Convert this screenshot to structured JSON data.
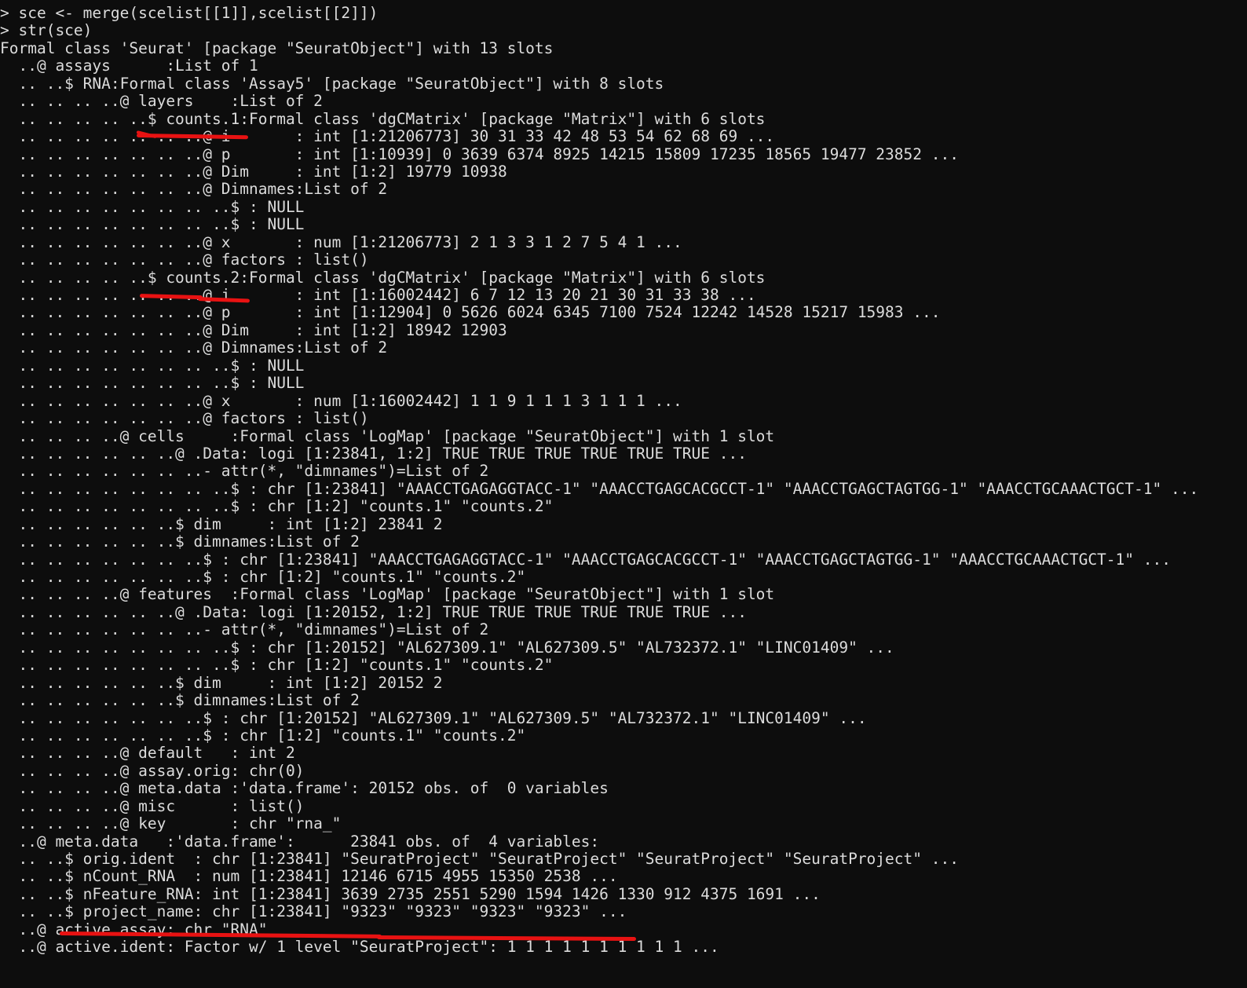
{
  "terminal": {
    "app": "R console",
    "background_color": "#0d0d0d",
    "text_color": "#dcdcdc",
    "annotation_color": "#e81212",
    "prompt": ">"
  },
  "lines": [
    "> sce <- merge(scelist[[1]],scelist[[2]])",
    "> str(sce)",
    "Formal class 'Seurat' [package \"SeuratObject\"] with 13 slots",
    "  ..@ assays      :List of 1",
    "  .. ..$ RNA:Formal class 'Assay5' [package \"SeuratObject\"] with 8 slots",
    "  .. .. .. ..@ layers    :List of 2",
    "  .. .. .. .. ..$ counts.1:Formal class 'dgCMatrix' [package \"Matrix\"] with 6 slots",
    "  .. .. .. .. .. .. ..@ i       : int [1:21206773] 30 31 33 42 48 53 54 62 68 69 ...",
    "  .. .. .. .. .. .. ..@ p       : int [1:10939] 0 3639 6374 8925 14215 15809 17235 18565 19477 23852 ...",
    "  .. .. .. .. .. .. ..@ Dim     : int [1:2] 19779 10938",
    "  .. .. .. .. .. .. ..@ Dimnames:List of 2",
    "  .. .. .. .. .. .. .. ..$ : NULL",
    "  .. .. .. .. .. .. .. ..$ : NULL",
    "  .. .. .. .. .. .. ..@ x       : num [1:21206773] 2 1 3 3 1 2 7 5 4 1 ...",
    "  .. .. .. .. .. .. ..@ factors : list()",
    "  .. .. .. .. ..$ counts.2:Formal class 'dgCMatrix' [package \"Matrix\"] with 6 slots",
    "  .. .. .. .. .. .. ..@ i       : int [1:16002442] 6 7 12 13 20 21 30 31 33 38 ...",
    "  .. .. .. .. .. .. ..@ p       : int [1:12904] 0 5626 6024 6345 7100 7524 12242 14528 15217 15983 ...",
    "  .. .. .. .. .. .. ..@ Dim     : int [1:2] 18942 12903",
    "  .. .. .. .. .. .. ..@ Dimnames:List of 2",
    "  .. .. .. .. .. .. .. ..$ : NULL",
    "  .. .. .. .. .. .. .. ..$ : NULL",
    "  .. .. .. .. .. .. ..@ x       : num [1:16002442] 1 1 9 1 1 1 3 1 1 1 ...",
    "  .. .. .. .. .. .. ..@ factors : list()",
    "  .. .. .. ..@ cells     :Formal class 'LogMap' [package \"SeuratObject\"] with 1 slot",
    "  .. .. .. .. .. ..@ .Data: logi [1:23841, 1:2] TRUE TRUE TRUE TRUE TRUE TRUE ...",
    "  .. .. .. .. .. .. ..- attr(*, \"dimnames\")=List of 2",
    "  .. .. .. .. .. .. .. ..$ : chr [1:23841] \"AAACCTGAGAGGTACC-1\" \"AAACCTGAGCACGCCT-1\" \"AAACCTGAGCTAGTGG-1\" \"AAACCTGCAAACTGCT-1\" ...",
    "  .. .. .. .. .. .. .. ..$ : chr [1:2] \"counts.1\" \"counts.2\"",
    "  .. .. .. .. .. ..$ dim     : int [1:2] 23841 2",
    "  .. .. .. .. .. ..$ dimnames:List of 2",
    "  .. .. .. .. .. .. ..$ : chr [1:23841] \"AAACCTGAGAGGTACC-1\" \"AAACCTGAGCACGCCT-1\" \"AAACCTGAGCTAGTGG-1\" \"AAACCTGCAAACTGCT-1\" ...",
    "  .. .. .. .. .. .. ..$ : chr [1:2] \"counts.1\" \"counts.2\"",
    "  .. .. .. ..@ features  :Formal class 'LogMap' [package \"SeuratObject\"] with 1 slot",
    "  .. .. .. .. .. ..@ .Data: logi [1:20152, 1:2] TRUE TRUE TRUE TRUE TRUE TRUE ...",
    "  .. .. .. .. .. .. ..- attr(*, \"dimnames\")=List of 2",
    "  .. .. .. .. .. .. .. ..$ : chr [1:20152] \"AL627309.1\" \"AL627309.5\" \"AL732372.1\" \"LINC01409\" ...",
    "  .. .. .. .. .. .. .. ..$ : chr [1:2] \"counts.1\" \"counts.2\"",
    "  .. .. .. .. .. ..$ dim     : int [1:2] 20152 2",
    "  .. .. .. .. .. ..$ dimnames:List of 2",
    "  .. .. .. .. .. .. ..$ : chr [1:20152] \"AL627309.1\" \"AL627309.5\" \"AL732372.1\" \"LINC01409\" ...",
    "  .. .. .. .. .. .. ..$ : chr [1:2] \"counts.1\" \"counts.2\"",
    "  .. .. .. ..@ default   : int 2",
    "  .. .. .. ..@ assay.orig: chr(0)",
    "  .. .. .. ..@ meta.data :'data.frame': 20152 obs. of  0 variables",
    "  .. .. .. ..@ misc      : list()",
    "  .. .. .. ..@ key       : chr \"rna_\"",
    "  ..@ meta.data   :'data.frame':      23841 obs. of  4 variables:",
    "  .. ..$ orig.ident  : chr [1:23841] \"SeuratProject\" \"SeuratProject\" \"SeuratProject\" \"SeuratProject\" ...",
    "  .. ..$ nCount_RNA  : num [1:23841] 12146 6715 4955 15350 2538 ...",
    "  .. ..$ nFeature_RNA: int [1:23841] 3639 2735 2551 5290 1594 1426 1330 912 4375 1691 ...",
    "  .. ..$ project_name: chr [1:23841] \"9323\" \"9323\" \"9323\" \"9323\" ...",
    "  ..@ active.assay: chr \"RNA\"",
    "  ..@ active.ident: Factor w/ 1 level \"SeuratProject\": 1 1 1 1 1 1 1 1 1 1 ..."
  ],
  "annotations": [
    {
      "name": "underline-counts-1",
      "target_text": "..$ counts.1",
      "color": "#e81212"
    },
    {
      "name": "underline-counts-2",
      "target_text": "..$ counts.2",
      "color": "#e81212"
    },
    {
      "name": "underline-project-name",
      "target_text": "$ project_name: chr [1:23841] \"9323\" \"9323\"",
      "color": "#e81212"
    }
  ]
}
